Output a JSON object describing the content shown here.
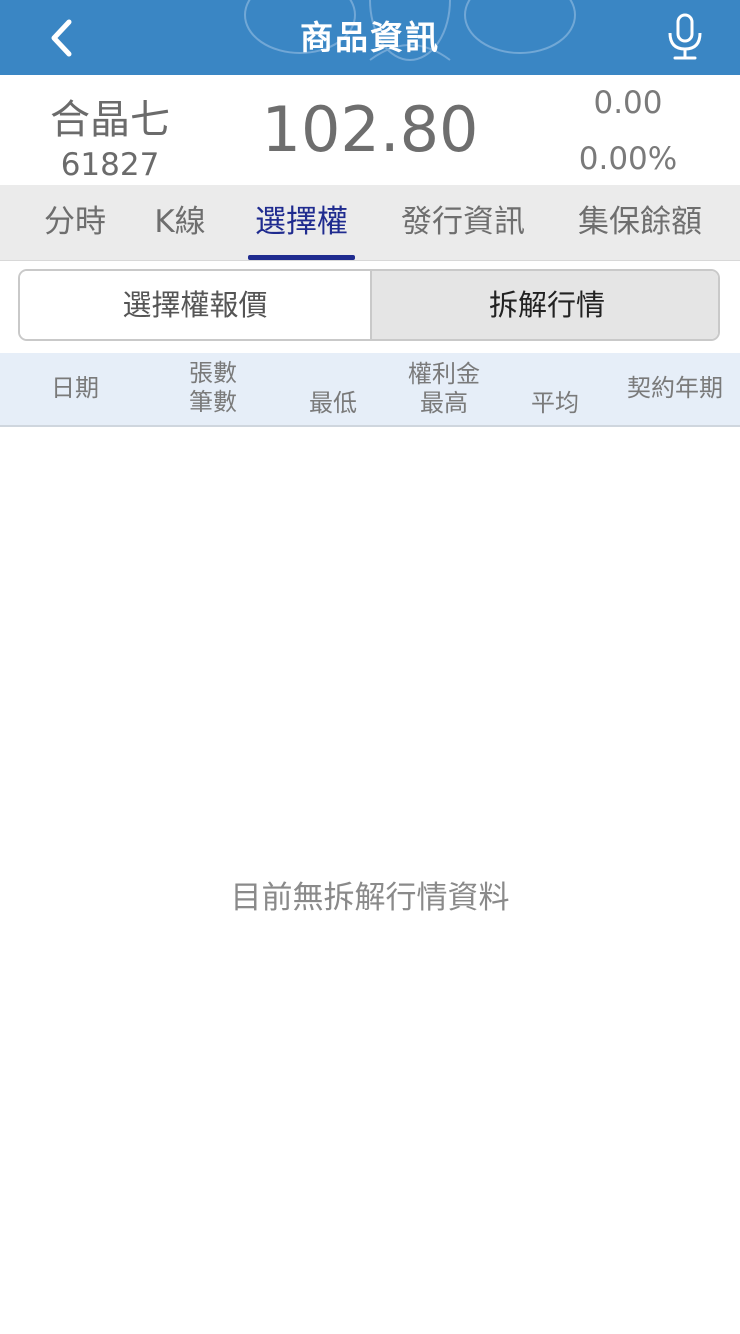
{
  "header": {
    "title": "商品資訊",
    "back_icon": "chevron-left-icon",
    "mic_icon": "microphone-icon",
    "background_color": "#3a86c4"
  },
  "quote": {
    "name": "合晶七",
    "code": "61827",
    "price": "102.80",
    "change": "0.00",
    "change_pct": "0.00%"
  },
  "tabs": [
    {
      "label": "分時",
      "active": false
    },
    {
      "label": "K線",
      "active": false
    },
    {
      "label": "選擇權",
      "active": true
    },
    {
      "label": "發行資訊",
      "active": false
    },
    {
      "label": "集保餘額",
      "active": false
    }
  ],
  "segment": {
    "left_label": "選擇權報價",
    "right_label": "拆解行情",
    "selected": "拆解行情"
  },
  "table": {
    "headers": {
      "date": "日期",
      "volume_top": "張數",
      "volume_bottom": "筆數",
      "low": "最低",
      "premium": "權利金",
      "high": "最高",
      "avg": "平均",
      "term": "契約年期"
    }
  },
  "empty_message": "目前無拆解行情資料",
  "colors": {
    "accent": "#1f2b8f",
    "header_bg": "#3a86c4",
    "table_header_bg": "#e6eef8"
  }
}
